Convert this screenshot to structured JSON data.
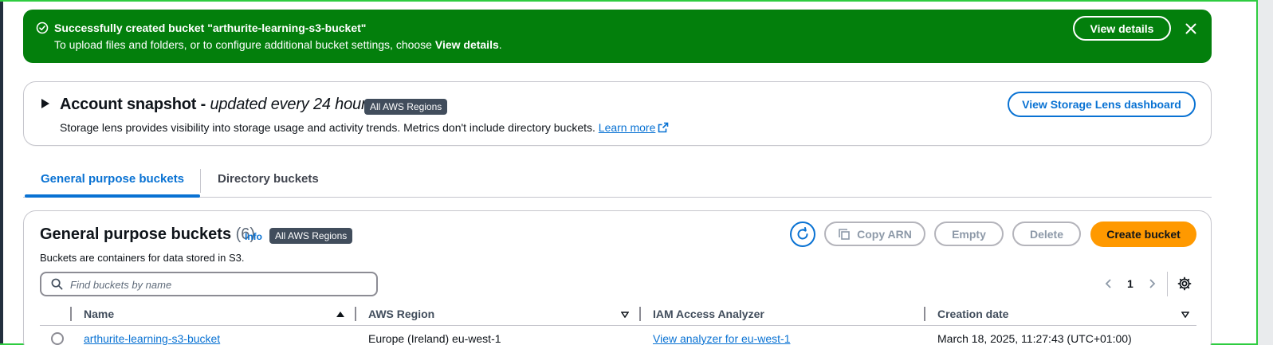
{
  "flash": {
    "title": "Successfully created bucket \"arthurite-learning-s3-bucket\"",
    "message_prefix": "To upload files and folders, or to configure additional bucket settings, choose ",
    "message_bold": "View details",
    "message_suffix": ".",
    "view_details_label": "View details",
    "color": "#037f0c"
  },
  "snapshot": {
    "title": "Account snapshot",
    "title_sep": " - ",
    "title_italic": "updated every 24 hours",
    "badge": "All AWS Regions",
    "description": "Storage lens provides visibility into storage usage and activity trends. Metrics don't include directory buckets. ",
    "learn_more": "Learn more",
    "lens_button": "View Storage Lens dashboard"
  },
  "tabs": [
    {
      "label": "General purpose buckets",
      "active": true
    },
    {
      "label": "Directory buckets",
      "active": false
    }
  ],
  "buckets": {
    "title": "General purpose buckets",
    "count": "(6)",
    "info": "Info",
    "badge": "All AWS Regions",
    "description": "Buckets are containers for data stored in S3.",
    "actions": {
      "copy_arn": "Copy ARN",
      "empty": "Empty",
      "delete": "Delete",
      "create": "Create bucket"
    },
    "search_placeholder": "Find buckets by name",
    "page": "1",
    "columns": [
      "Name",
      "AWS Region",
      "IAM Access Analyzer",
      "Creation date"
    ],
    "rows": [
      {
        "name": "arthurite-learning-s3-bucket",
        "region": "Europe (Ireland) eu-west-1",
        "analyzer": "View analyzer for eu-west-1",
        "created": "March 18, 2025, 11:27:43 (UTC+01:00)"
      }
    ],
    "accent_color": "#ff9900"
  }
}
